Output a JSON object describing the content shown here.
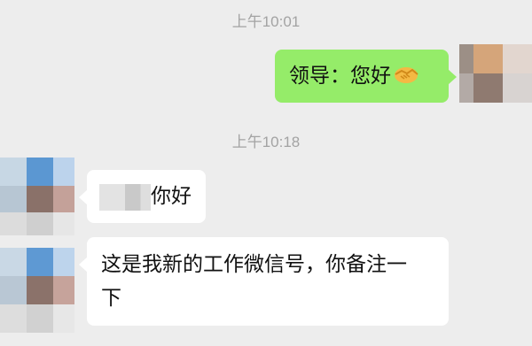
{
  "timestamps": [
    "上午10:01",
    "上午10:18"
  ],
  "messages": [
    {
      "side": "out",
      "text": "领导：您好",
      "emoji_icon": "handshake-icon"
    },
    {
      "side": "in",
      "text": "你好"
    },
    {
      "side": "in",
      "text": "这是我新的工作微信号，你备注一",
      "text_line2": "下"
    }
  ],
  "colors": {
    "background": "#ededed",
    "outgoing_bubble": "#95ec69",
    "incoming_bubble": "#ffffff",
    "timestamp": "#a3a3a3"
  }
}
